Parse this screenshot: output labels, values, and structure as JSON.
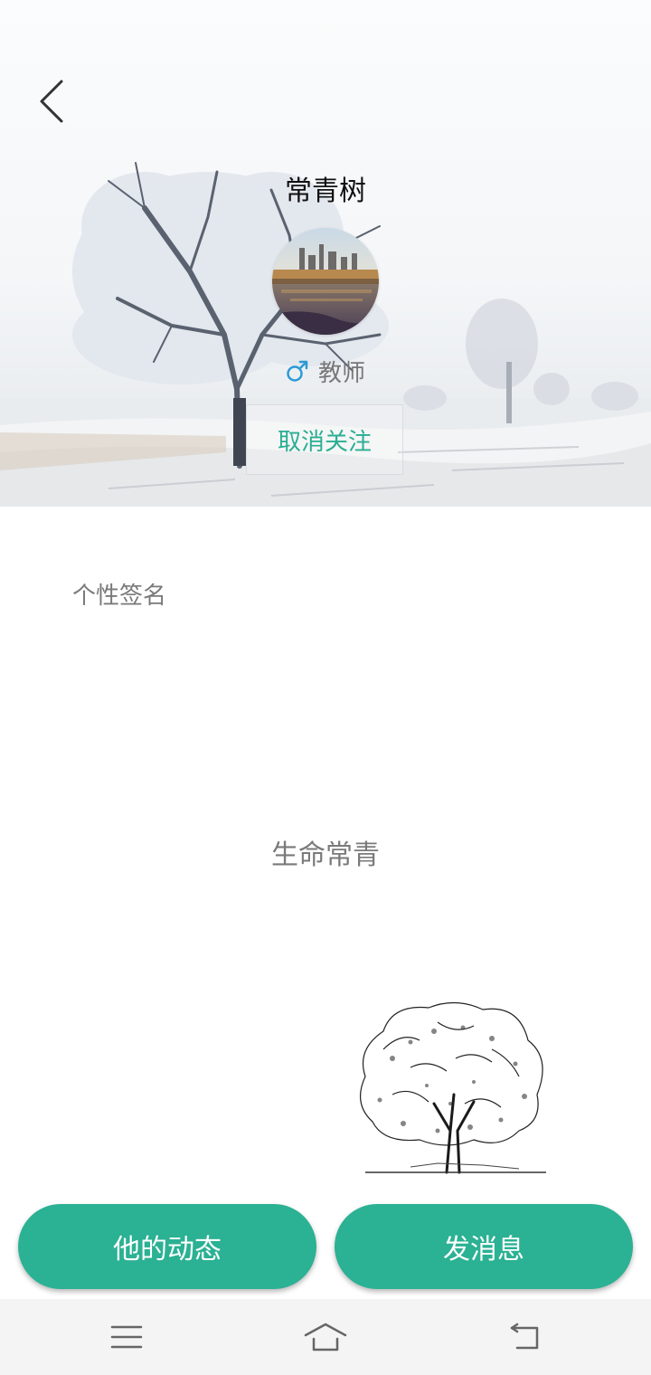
{
  "header": {
    "back_icon": "chevron-left-icon",
    "name": "常青树",
    "gender_icon": "male-icon",
    "role": "教师",
    "follow_button": "取消关注"
  },
  "signature": {
    "heading": "个性签名",
    "text": "生命常青"
  },
  "actions": {
    "posts_button": "他的动态",
    "message_button": "发消息"
  },
  "system_nav": {
    "menu_icon": "menu-icon",
    "home_icon": "home-icon",
    "back_icon": "back-icon"
  },
  "colors": {
    "accent": "#2bb193",
    "follow_text": "#2aae93",
    "gender_blue": "#2d9ad6",
    "muted_text": "#7a7a7a"
  }
}
